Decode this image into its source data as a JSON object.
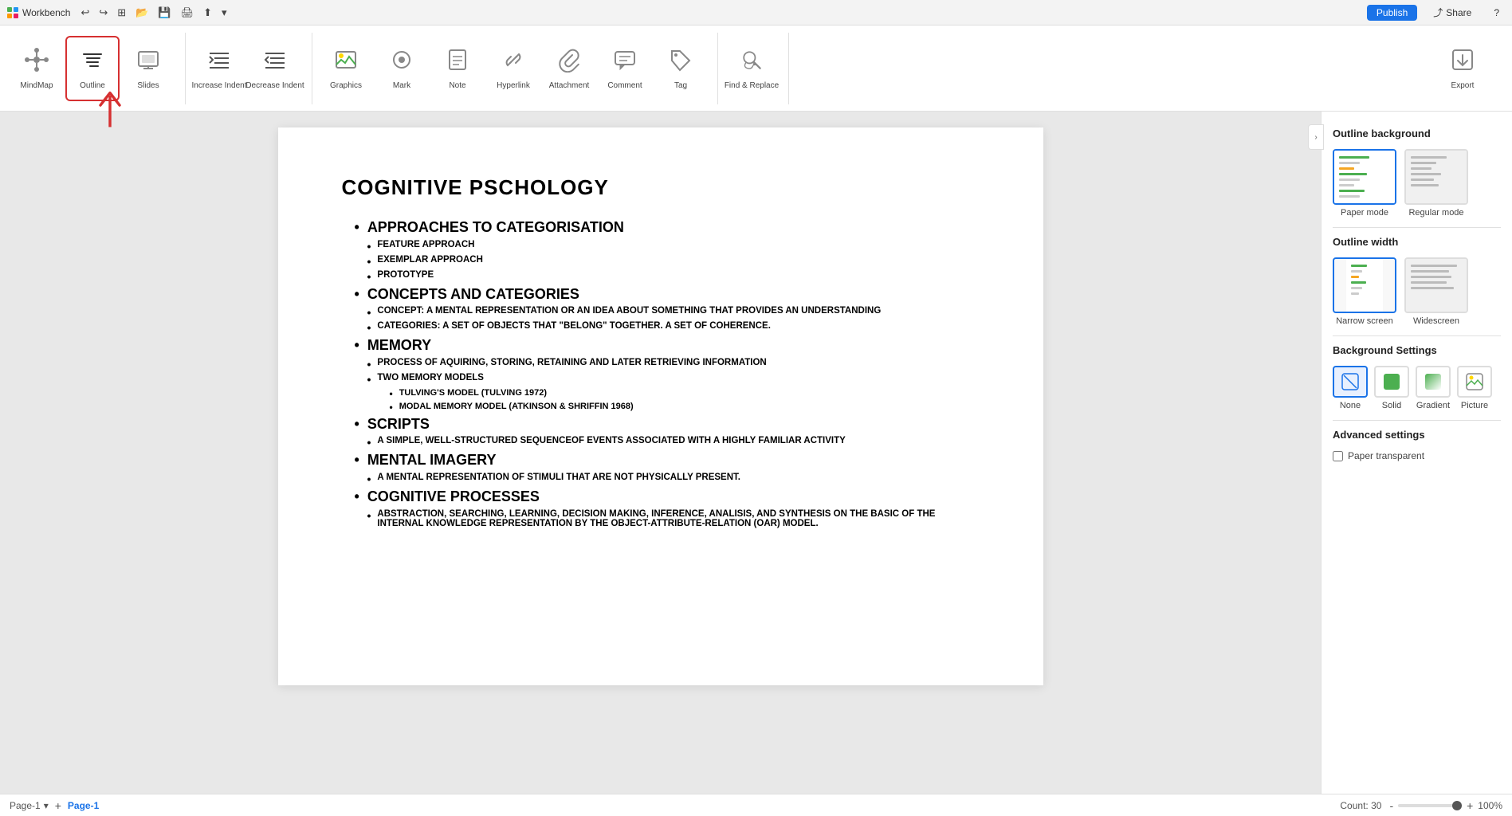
{
  "titlebar": {
    "app_name": "Workbench",
    "undo": "Undo",
    "redo": "Redo",
    "new_tab": "New Tab",
    "open": "Open",
    "save": "Save",
    "print": "Print",
    "export": "Export",
    "publish_label": "Publish",
    "share_label": "Share",
    "help_label": "?"
  },
  "toolbar": {
    "mindmap_label": "MindMap",
    "outline_label": "Outline",
    "slides_label": "Slides",
    "increase_indent_label": "Increase Indent",
    "decrease_indent_label": "Decrease Indent",
    "graphics_label": "Graphics",
    "mark_label": "Mark",
    "note_label": "Note",
    "hyperlink_label": "Hyperlink",
    "attachment_label": "Attachment",
    "comment_label": "Comment",
    "tag_label": "Tag",
    "find_replace_label": "Find & Replace",
    "export_label": "Export"
  },
  "document": {
    "title": "COGNITIVE PSCHOLOGY",
    "sections": [
      {
        "heading": "APPROACHES TO CATEGORISATION",
        "children": [
          {
            "text": "FEATURE APPROACH",
            "level": 2
          },
          {
            "text": "EXEMPLAR APPROACH",
            "level": 2
          },
          {
            "text": "PROTOTYPE",
            "level": 2
          }
        ]
      },
      {
        "heading": "CONCEPTS AND CATEGORIES",
        "children": [
          {
            "text": "CONCEPT: A MENTAL REPRESENTATION OR AN IDEA ABOUT SOMETHING THAT PROVIDES AN UNDERSTANDING",
            "level": 2
          },
          {
            "text": "CATEGORIES: A SET OF OBJECTS THAT \"BELONG\" TOGETHER. A SET OF COHERENCE.",
            "level": 2
          }
        ]
      },
      {
        "heading": "MEMORY",
        "children": [
          {
            "text": "PROCESS OF AQUIRING, STORING, RETAINING AND LATER RETRIEVING INFORMATION",
            "level": 2
          },
          {
            "text": "TWO MEMORY MODELS",
            "level": 2,
            "children": [
              {
                "text": "TULVING'S MODEL (TULVING 1972)",
                "level": 3
              },
              {
                "text": "MODAL MEMORY MODEL (ATKINSON & SHRIFFIN 1968)",
                "level": 3
              }
            ]
          }
        ]
      },
      {
        "heading": "SCRIPTS",
        "children": [
          {
            "text": "A SIMPLE, WELL-STRUCTURED SEQUENCEOF EVENTS ASSOCIATED WITH A HIGHLY FAMILIAR ACTIVITY",
            "level": 2
          }
        ]
      },
      {
        "heading": "MENTAL IMAGERY",
        "children": [
          {
            "text": "A MENTAL REPRESENTATION OF STIMULI THAT ARE NOT PHYSICALLY PRESENT.",
            "level": 2
          }
        ]
      },
      {
        "heading": "COGNITIVE PROCESSES",
        "children": [
          {
            "text": "ABSTRACTION, SEARCHING, LEARNING, DECISION MAKING, INFERENCE, ANALISIS, AND SYNTHESIS ON THE BASIC OF THE INTERNAL KNOWLEDGE REPRESENTATION BY THE OBJECT-ATTRIBUTE-RELATION (OAR) MODEL.",
            "level": 2
          }
        ]
      }
    ]
  },
  "right_panel": {
    "outline_background_title": "Outline background",
    "paper_mode_label": "Paper mode",
    "regular_mode_label": "Regular mode",
    "outline_width_title": "Outline width",
    "narrow_screen_label": "Narrow screen",
    "widescreen_label": "Widescreen",
    "background_settings_title": "Background Settings",
    "none_label": "None",
    "solid_label": "Solid",
    "gradient_label": "Gradient",
    "picture_label": "Picture",
    "advanced_settings_title": "Advanced settings",
    "paper_transparent_label": "Paper transparent"
  },
  "statusbar": {
    "page_label": "Page-1",
    "add_page_label": "+",
    "active_page_label": "Page-1",
    "count_label": "Count: 30",
    "zoom_minus": "-",
    "zoom_plus": "+",
    "zoom_level": "100%"
  }
}
